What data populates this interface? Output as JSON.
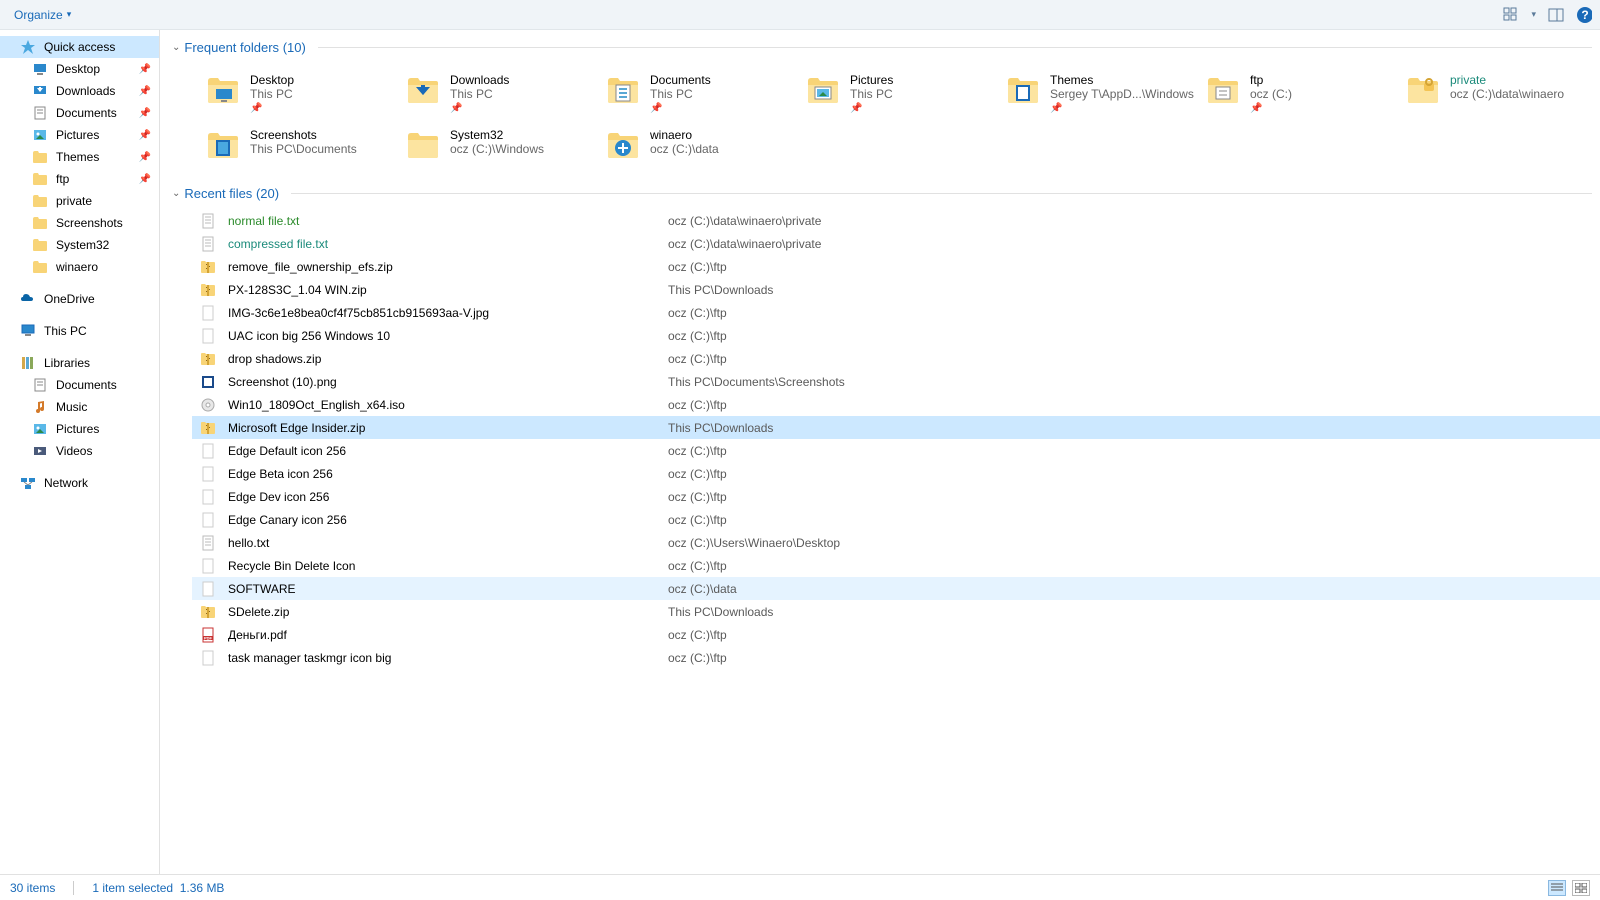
{
  "toolbar": {
    "organize": "Organize"
  },
  "sidebar": {
    "quickaccess": "Quick access",
    "qa_items": [
      {
        "label": "Desktop",
        "pin": true,
        "icon": "desktop"
      },
      {
        "label": "Downloads",
        "pin": true,
        "icon": "downloads"
      },
      {
        "label": "Documents",
        "pin": true,
        "icon": "documents"
      },
      {
        "label": "Pictures",
        "pin": true,
        "icon": "pictures"
      },
      {
        "label": "Themes",
        "pin": true,
        "icon": "folder"
      },
      {
        "label": "ftp",
        "pin": true,
        "icon": "folder"
      },
      {
        "label": "private",
        "pin": false,
        "icon": "folder"
      },
      {
        "label": "Screenshots",
        "pin": false,
        "icon": "folder"
      },
      {
        "label": "System32",
        "pin": false,
        "icon": "folder"
      },
      {
        "label": "winaero",
        "pin": false,
        "icon": "folder"
      }
    ],
    "onedrive": "OneDrive",
    "thispc": "This PC",
    "libraries": "Libraries",
    "lib_items": [
      {
        "label": "Documents",
        "icon": "documents"
      },
      {
        "label": "Music",
        "icon": "music"
      },
      {
        "label": "Pictures",
        "icon": "pictures"
      },
      {
        "label": "Videos",
        "icon": "videos"
      }
    ],
    "network": "Network"
  },
  "sections": {
    "frequent": {
      "label": "Frequent folders",
      "count": "(10)"
    },
    "recent": {
      "label": "Recent files",
      "count": "(20)"
    }
  },
  "folders": [
    {
      "name": "Desktop",
      "sub": "This PC",
      "pin": true,
      "icon": "desktop-big"
    },
    {
      "name": "Downloads",
      "sub": "This PC",
      "pin": true,
      "icon": "downloads-big"
    },
    {
      "name": "Documents",
      "sub": "This PC",
      "pin": true,
      "icon": "documents-big"
    },
    {
      "name": "Pictures",
      "sub": "This PC",
      "pin": true,
      "icon": "pictures-big"
    },
    {
      "name": "Themes",
      "sub": "Sergey T\\AppD...\\Windows",
      "pin": true,
      "icon": "themes-big"
    },
    {
      "name": "ftp",
      "sub": "ocz (C:)",
      "pin": true,
      "icon": "ftp-big"
    },
    {
      "name": "private",
      "sub": "ocz (C:)\\data\\winaero",
      "pin": false,
      "icon": "private-big",
      "namecolor": "teal"
    },
    {
      "name": "Screenshots",
      "sub": "This PC\\Documents",
      "pin": false,
      "icon": "screenshots-big"
    },
    {
      "name": "System32",
      "sub": "ocz (C:)\\Windows",
      "pin": false,
      "icon": "folder-big"
    },
    {
      "name": "winaero",
      "sub": "ocz (C:)\\data",
      "pin": false,
      "icon": "winaero-big"
    }
  ],
  "files": [
    {
      "name": "normal file.txt",
      "path": "ocz (C:)\\data\\winaero\\private",
      "icon": "txt",
      "color": "green"
    },
    {
      "name": "compressed file.txt",
      "path": "ocz (C:)\\data\\winaero\\private",
      "icon": "txt",
      "color": "teal"
    },
    {
      "name": "remove_file_ownership_efs.zip",
      "path": "ocz (C:)\\ftp",
      "icon": "zip"
    },
    {
      "name": "PX-128S3C_1.04 WIN.zip",
      "path": "This PC\\Downloads",
      "icon": "zip"
    },
    {
      "name": "IMG-3c6e1e8bea0cf4f75cb851cb915693aa-V.jpg",
      "path": "ocz (C:)\\ftp",
      "icon": "blank"
    },
    {
      "name": "UAC icon big 256 Windows 10",
      "path": "ocz (C:)\\ftp",
      "icon": "blank"
    },
    {
      "name": "drop shadows.zip",
      "path": "ocz (C:)\\ftp",
      "icon": "zip"
    },
    {
      "name": "Screenshot (10).png",
      "path": "This PC\\Documents\\Screenshots",
      "icon": "png"
    },
    {
      "name": "Win10_1809Oct_English_x64.iso",
      "path": "ocz (C:)\\ftp",
      "icon": "iso"
    },
    {
      "name": "Microsoft Edge Insider.zip",
      "path": "This PC\\Downloads",
      "icon": "zip",
      "sel": true
    },
    {
      "name": "Edge Default icon 256",
      "path": "ocz (C:)\\ftp",
      "icon": "blank"
    },
    {
      "name": "Edge Beta icon 256",
      "path": "ocz (C:)\\ftp",
      "icon": "blank"
    },
    {
      "name": "Edge Dev icon 256",
      "path": "ocz (C:)\\ftp",
      "icon": "blank"
    },
    {
      "name": "Edge Canary icon 256",
      "path": "ocz (C:)\\ftp",
      "icon": "blank"
    },
    {
      "name": "hello.txt",
      "path": "ocz (C:)\\Users\\Winaero\\Desktop",
      "icon": "txt"
    },
    {
      "name": "Recycle Bin Delete Icon",
      "path": "ocz (C:)\\ftp",
      "icon": "blank"
    },
    {
      "name": "SOFTWARE",
      "path": "ocz (C:)\\data",
      "icon": "blank",
      "hover": true
    },
    {
      "name": "SDelete.zip",
      "path": "This PC\\Downloads",
      "icon": "zip"
    },
    {
      "name": "Деньги.pdf",
      "path": "ocz (C:)\\ftp",
      "icon": "pdf"
    },
    {
      "name": "task manager taskmgr icon big",
      "path": "ocz (C:)\\ftp",
      "icon": "blank"
    }
  ],
  "status": {
    "items": "30 items",
    "selected": "1 item selected",
    "size": "1.36 MB"
  }
}
